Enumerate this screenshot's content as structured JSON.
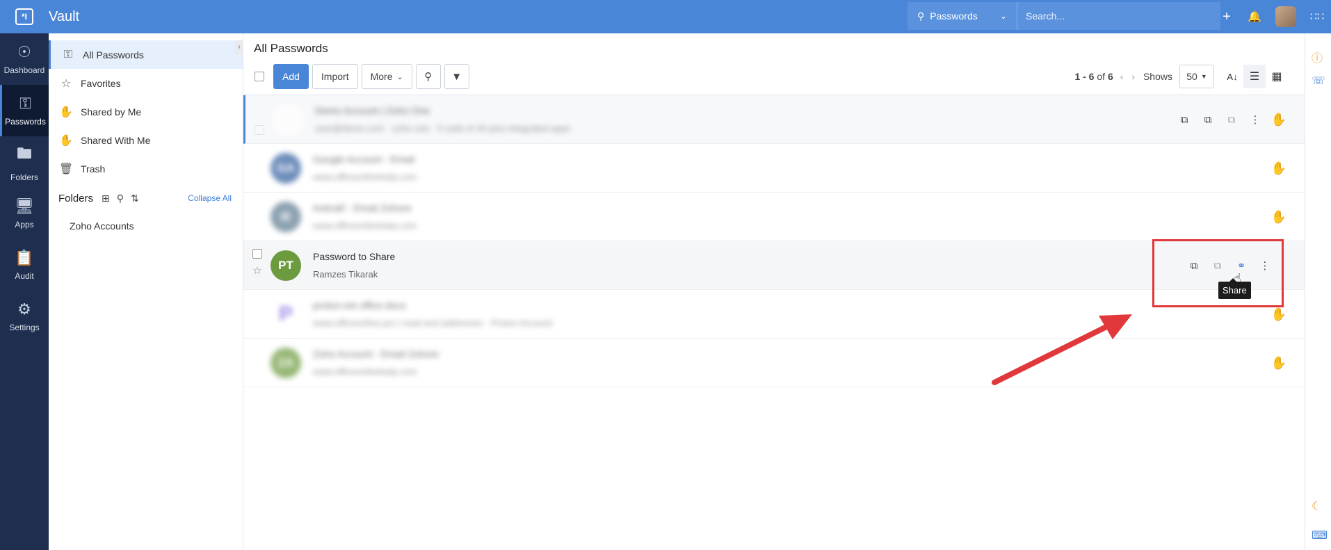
{
  "app": {
    "title": "Vault"
  },
  "topbar": {
    "search_scope": "Passwords",
    "search_placeholder": "Search..."
  },
  "leftnav": [
    {
      "label": "Dashboard",
      "icon": "compass-icon"
    },
    {
      "label": "Passwords",
      "icon": "key-icon",
      "active": true
    },
    {
      "label": "Folders",
      "icon": "folder-icon"
    },
    {
      "label": "Apps",
      "icon": "sso-monitor-icon"
    },
    {
      "label": "Audit",
      "icon": "audit-icon"
    },
    {
      "label": "Settings",
      "icon": "gear-icon"
    }
  ],
  "sidebar": {
    "items": [
      {
        "label": "All Passwords",
        "icon": "key-icon",
        "active": true
      },
      {
        "label": "Favorites",
        "icon": "star-icon"
      },
      {
        "label": "Shared by Me",
        "icon": "share-hand-icon"
      },
      {
        "label": "Shared With Me",
        "icon": "receive-hand-icon"
      },
      {
        "label": "Trash",
        "icon": "trash-icon"
      }
    ],
    "folders_title": "Folders",
    "collapse_all": "Collapse All",
    "folders": [
      "Zoho Accounts"
    ]
  },
  "main": {
    "title": "All Passwords",
    "toolbar": {
      "add": "Add",
      "import": "Import",
      "more": "More"
    },
    "pager": {
      "range": "1 - 6",
      "of": "of",
      "total": "6",
      "shows_label": "Shows",
      "page_size": "50"
    }
  },
  "rows": [
    {
      "name": "Demo Account | Zoho One",
      "sub": "user@demo.com · zoho one · 5 suite of 40 plus integrated apps",
      "initials": "",
      "color": "#e9b3b3",
      "blurred": true
    },
    {
      "name": "Google Account - Email",
      "sub": "www.officeonlinehelp.com",
      "initials": "GA",
      "color": "#2f5d9f",
      "blurred": true
    },
    {
      "name": "Instrukf - Email Zohore",
      "sub": "www.officeonlinehelp.com",
      "initials": "IE",
      "color": "#5b7a8f",
      "blurred": true
    },
    {
      "name": "Password to Share",
      "sub": "Ramzes Tikarak",
      "initials": "PT",
      "color": "#6c9a3e",
      "blurred": false
    },
    {
      "name": "proton.me office docs",
      "sub": "www.officeonline.pro | read and addresses · Proton Account",
      "initials": "P",
      "color": "#7b5ce0",
      "blurred": true
    },
    {
      "name": "Zoho Account - Email Zohore",
      "sub": "www.officeonlinehelp.com",
      "initials": "ZA",
      "color": "#6c9a3e",
      "blurred": true
    }
  ],
  "tooltip": {
    "text": "Share"
  }
}
